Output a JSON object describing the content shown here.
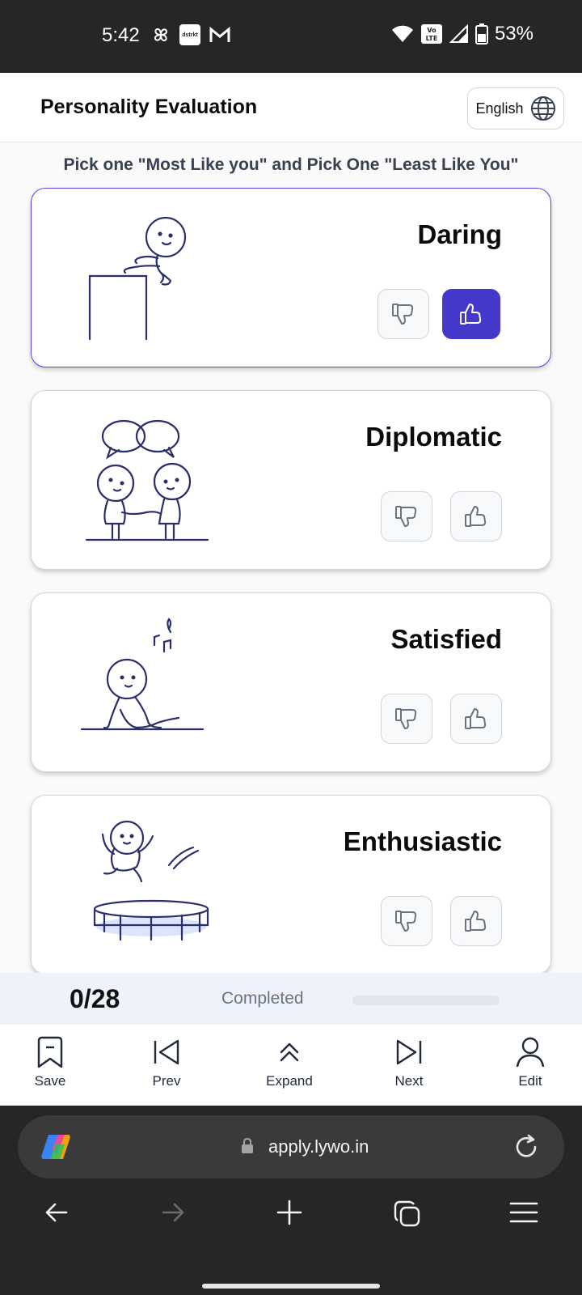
{
  "status_bar": {
    "time": "5:42",
    "battery": "53%",
    "app_badge": "dstrkt"
  },
  "header": {
    "title": "Personality Evaluation",
    "language": "English"
  },
  "instruction": "Pick one \"Most Like you\" and Pick One \"Least Like You\"",
  "cards": [
    {
      "trait": "Daring",
      "selected": "like"
    },
    {
      "trait": "Diplomatic",
      "selected": "none"
    },
    {
      "trait": "Satisfied",
      "selected": "none"
    },
    {
      "trait": "Enthusiastic",
      "selected": "none"
    }
  ],
  "progress": {
    "count": "0/28",
    "label": "Completed",
    "fraction": 0
  },
  "bottom_nav": {
    "save": "Save",
    "prev": "Prev",
    "expand": "Expand",
    "next": "Next",
    "edit": "Edit"
  },
  "browser": {
    "url": "apply.lywo.in"
  },
  "colors": {
    "accent": "#4338ca",
    "card_border": "#d1d5db",
    "status_bg": "#262626"
  }
}
